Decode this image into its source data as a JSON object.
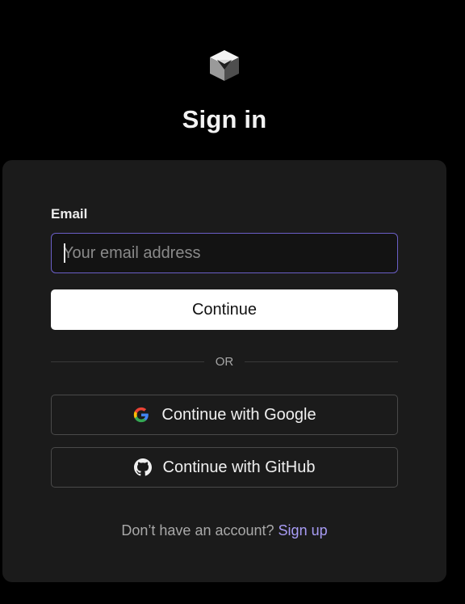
{
  "header": {
    "logo_icon": "cube-logo-icon",
    "title": "Sign in"
  },
  "form": {
    "email_label": "Email",
    "email_value": "",
    "email_placeholder": "Your email address",
    "continue_label": "Continue",
    "divider_text": "OR",
    "google_label": "Continue with Google",
    "google_icon": "google-icon",
    "github_label": "Continue with GitHub",
    "github_icon": "github-icon"
  },
  "footer": {
    "prompt": "Don’t have an account?",
    "signup_label": "Sign up"
  },
  "colors": {
    "background": "#000000",
    "card": "#1b1b1b",
    "input_focus_border": "#6b5fc7",
    "link": "#a89cf5",
    "primary_button": "#ffffff"
  }
}
